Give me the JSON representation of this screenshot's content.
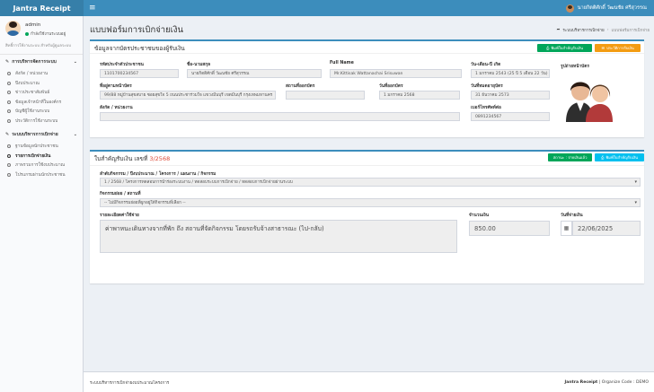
{
  "app": {
    "brand": "Jantra Receipt",
    "menu_icon": "hamburger-icon"
  },
  "topbar": {
    "user_name": "นายกิตติศักดิ์ วัฒนชัย ศรีสุวรรณ"
  },
  "sidebar": {
    "user_name": "admin",
    "user_status": "กำลังใช้งานระบบอยู่",
    "note": "สิทธิ์การใช้งานระบบ สำหรับผู้ดูแลระบบ",
    "groups": [
      {
        "title": "การบริหารจัดการระบบ",
        "items": [
          "สังกัด / หน่วยงาน",
          "ปีงบประมาณ",
          "ข่าวประชาสัมพันธ์",
          "ข้อมูลเจ้าหน้าที่ในองค์กร",
          "บัญชีผู้ใช้งานระบบ",
          "ประวัติการใช้งานระบบ"
        ]
      },
      {
        "title": "ระบบบริหารการเบิกจ่าย",
        "items": [
          "ฐานข้อมูลนักประชาชน",
          "รายการเบิกจ่ายเงิน",
          "ภาพรวมการใช้งบประมาณ",
          "โปรแกรมผ่านนักประชาชน"
        ]
      }
    ]
  },
  "page": {
    "title": "แบบฟอร์มการเบิกจ่ายเงิน",
    "breadcrumb": [
      "ระบบบริหารการเบิกจ่าย",
      "แบบฟอร์มการเบิกจ่าย"
    ]
  },
  "person_box": {
    "title": "ข้อมูลจากบัตรประชาชนของผู้รับเงิน",
    "btn_print": "พิมพ์ใบสำคัญรับเงิน",
    "btn_history": "ประวัติการรับเงิน",
    "labels": {
      "citizen_id": "รหัสประจำตัวประชาชน",
      "name_th": "ชื่อ-นามสกุล",
      "name_en": "Full Name",
      "birthdate": "วัน-เดือน-ปี เกิด",
      "photo": "รูปถ่ายหน้าบัตร",
      "address": "ที่อยู่ตามหน้าบัตร",
      "issuer": "สถานที่ออกบัตร",
      "issue_date": "วันที่ออกบัตร",
      "expiry_date": "วันที่หมดอายุบัตร",
      "agency": "สังกัด / หน่วยงาน",
      "phone": "เบอร์โทรศัพท์ต่อ"
    },
    "values": {
      "citizen_id": "1101700234567",
      "name_th": "นายกิตติศักดิ์ วัฒนชัย ศรีสุวรรณ",
      "name_en": "Mr.Kittisak Wattanachai Srisuwan",
      "birthdate": "1 มกราคม 2543 (25 ปี 5 เดือน 22 วัน)",
      "address": "99/88 หมู่บ้านสุขสบาย ซอยสุขใจ 5 ถนนประชาร่วมใจ แขวงมีนบุรี เขตมีนบุรี กรุงเทพมหานคร",
      "issuer": "",
      "issue_date": "1 มกราคม 2568",
      "expiry_date": "31 ธันวาคม 2573",
      "agency": "",
      "phone": "0891234567"
    }
  },
  "receipt_box": {
    "title_prefix": "ใบสำคัญรับเงิน เลขที่",
    "number": "3/2568",
    "status_btn": "สถานะ : จ่ายเงินแล้ว",
    "print_btn": "พิมพ์ใบสำคัญรับเงิน",
    "labels": {
      "plan": "ลำดับกิจกรรม / ปีงบประมาณ / โครงการ / แผนงาน / กิจกรรม",
      "subactivity": "กิจกรรมย่อย / สถานที่",
      "expense_detail": "รายละเอียดค่าใช้จ่าย",
      "amount": "จำนวนเงิน",
      "pay_date": "วันที่จ่ายเงิน"
    },
    "values": {
      "plan": "1 / 2568 / โครงการทดสอบการนำร่องระบบงาน / ทดสอบระบบการเบิกจ่าย / ทดสอบการเบิกจ่ายผ่านระบบ",
      "subactivity": "-- ไม่มีกิจกรรมย่อยที่ผูกอยู่ใต้กิจกรรมที่เลือก --",
      "expense_detail": "ค่าพาหนะเดินทางจากที่พัก ถึง สถานที่จัดกิจกรรม โดยรถรับจ้างสาธารณะ (ไป-กลับ)",
      "amount": "850.00",
      "pay_date": "22/06/2025"
    }
  },
  "footer": {
    "left": "ระบบบริหารการเบิกจ่ายงบประมาณโครงการ",
    "right_brand": "Jantra Receipt",
    "right_rest": " | Organize Code : DEMO"
  },
  "colors": {
    "primary": "#3c8dbc",
    "green": "#00a65a",
    "orange": "#f39c12",
    "cyan": "#00c0ef",
    "red": "#dd4b39"
  }
}
